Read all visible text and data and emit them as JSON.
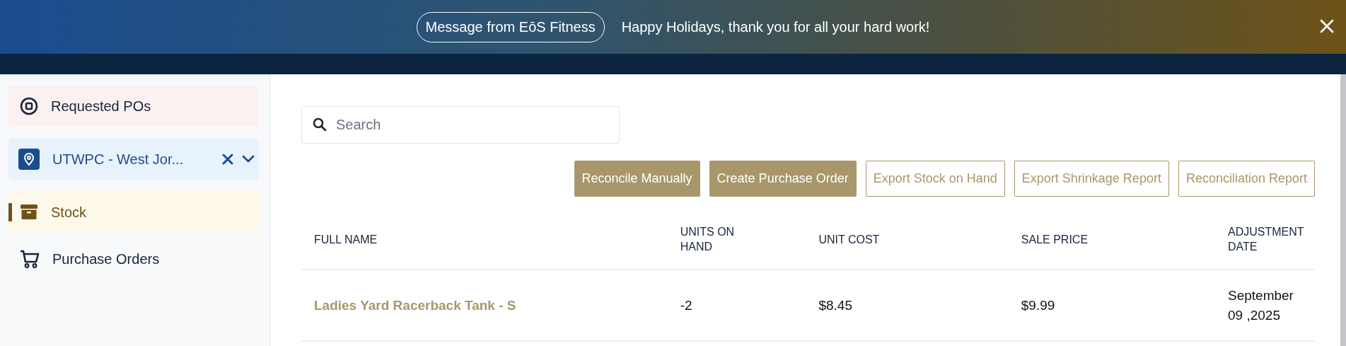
{
  "banner": {
    "badge": "Message from EōS Fitness",
    "message": "Happy Holidays, thank you for all your hard work!"
  },
  "sidebar": {
    "items": [
      {
        "kind": "requests",
        "label": "Requested POs",
        "selected": false
      },
      {
        "kind": "location",
        "label": "UTWPC - West Jor...",
        "selected": false
      },
      {
        "kind": "stock",
        "label": "Stock",
        "selected": true
      },
      {
        "kind": "orders",
        "label": "Purchase Orders",
        "selected": false
      }
    ]
  },
  "search": {
    "placeholder": "Search"
  },
  "buttons": [
    {
      "label": "Reconcile Manually",
      "kind": "filled"
    },
    {
      "label": "Create Purchase Order",
      "kind": "filled"
    },
    {
      "label": "Export Stock on Hand",
      "kind": "outline"
    },
    {
      "label": "Export Shrinkage Report",
      "kind": "outline"
    },
    {
      "label": "Reconciliation Report",
      "kind": "outline"
    }
  ],
  "table": {
    "columns": [
      "FULL NAME",
      "UNITS ON HAND",
      "UNIT COST",
      "SALE PRICE",
      "ADJUSTMENT DATE"
    ],
    "rows": [
      {
        "cells": [
          "Ladies Yard Racerback Tank - S",
          "-2",
          "$8.45",
          "$9.99",
          "September 09 ,2025"
        ]
      }
    ]
  }
}
